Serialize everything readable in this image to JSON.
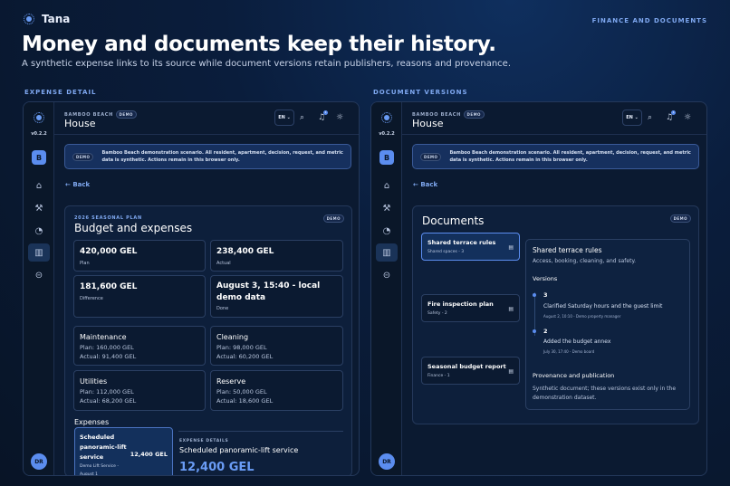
{
  "brand": "Tana",
  "top_label": "FINANCE AND DOCUMENTS",
  "headline": "Money and documents keep their history.",
  "subheadline": "A synthetic expense links to its source while document versions retain publishers, reasons and provenance.",
  "left_section_label": "EXPENSE DETAIL",
  "right_section_label": "DOCUMENT VERSIONS",
  "app": {
    "version": "v0.2.2",
    "building_initial": "B",
    "avatar": "DR",
    "org": "BAMBOO BEACH",
    "demo_tag": "DEMO",
    "house": "House",
    "lang": "EN",
    "notif_count": "1"
  },
  "banner": {
    "tag": "DEMO",
    "text": "Bamboo Beach demonstration scenario. All resident, apartment, decision, request, and metric data is synthetic. Actions remain in this browser only."
  },
  "back_label": "Back",
  "budget": {
    "eyebrow": "2026 SEASONAL PLAN",
    "title": "Budget and expenses",
    "tag": "DEMO",
    "plan": {
      "value": "420,000 GEL",
      "label": "Plan"
    },
    "actual": {
      "value": "238,400 GEL",
      "label": "Actual"
    },
    "difference": {
      "value": "181,600 GEL",
      "label": "Difference"
    },
    "done": {
      "value": "August 3, 15:40 - local demo data",
      "label": "Done"
    },
    "categories": [
      {
        "name": "Maintenance",
        "plan": "Plan: 160,000 GEL",
        "actual": "Actual: 91,400 GEL"
      },
      {
        "name": "Cleaning",
        "plan": "Plan: 98,000 GEL",
        "actual": "Actual: 60,200 GEL"
      },
      {
        "name": "Utilities",
        "plan": "Plan: 112,000 GEL",
        "actual": "Actual: 68,200 GEL"
      },
      {
        "name": "Reserve",
        "plan": "Plan: 50,000 GEL",
        "actual": "Actual: 18,600 GEL"
      }
    ],
    "expenses_label": "Expenses",
    "expense": {
      "title": "Scheduled panoramic-lift service",
      "amount": "12,400 GEL",
      "meta": "Demo Lift Service - August 1"
    },
    "details": {
      "eyebrow": "EXPENSE DETAILS",
      "title": "Scheduled panoramic-lift service",
      "amount": "12,400 GEL"
    }
  },
  "documents": {
    "title": "Documents",
    "tag": "DEMO",
    "items": [
      {
        "title": "Shared terrace rules",
        "meta": "Shared spaces - 3"
      },
      {
        "title": "Fire inspection plan",
        "meta": "Safety - 2"
      },
      {
        "title": "Seasonal budget report",
        "meta": "Finance - 1"
      }
    ],
    "detail": {
      "title": "Shared terrace rules",
      "desc": "Access, booking, cleaning, and safety.",
      "versions_label": "Versions",
      "versions": [
        {
          "num": "3",
          "text": "Clarified Saturday hours and the guest limit",
          "meta": "August 2, 10:10 - Demo property manager"
        },
        {
          "num": "2",
          "text": "Added the budget annex",
          "meta": "July 30, 17:40 - Demo board"
        }
      ],
      "prov_label": "Provenance and publication",
      "prov_text": "Synthetic document; these versions exist only in the demonstration dataset."
    }
  }
}
